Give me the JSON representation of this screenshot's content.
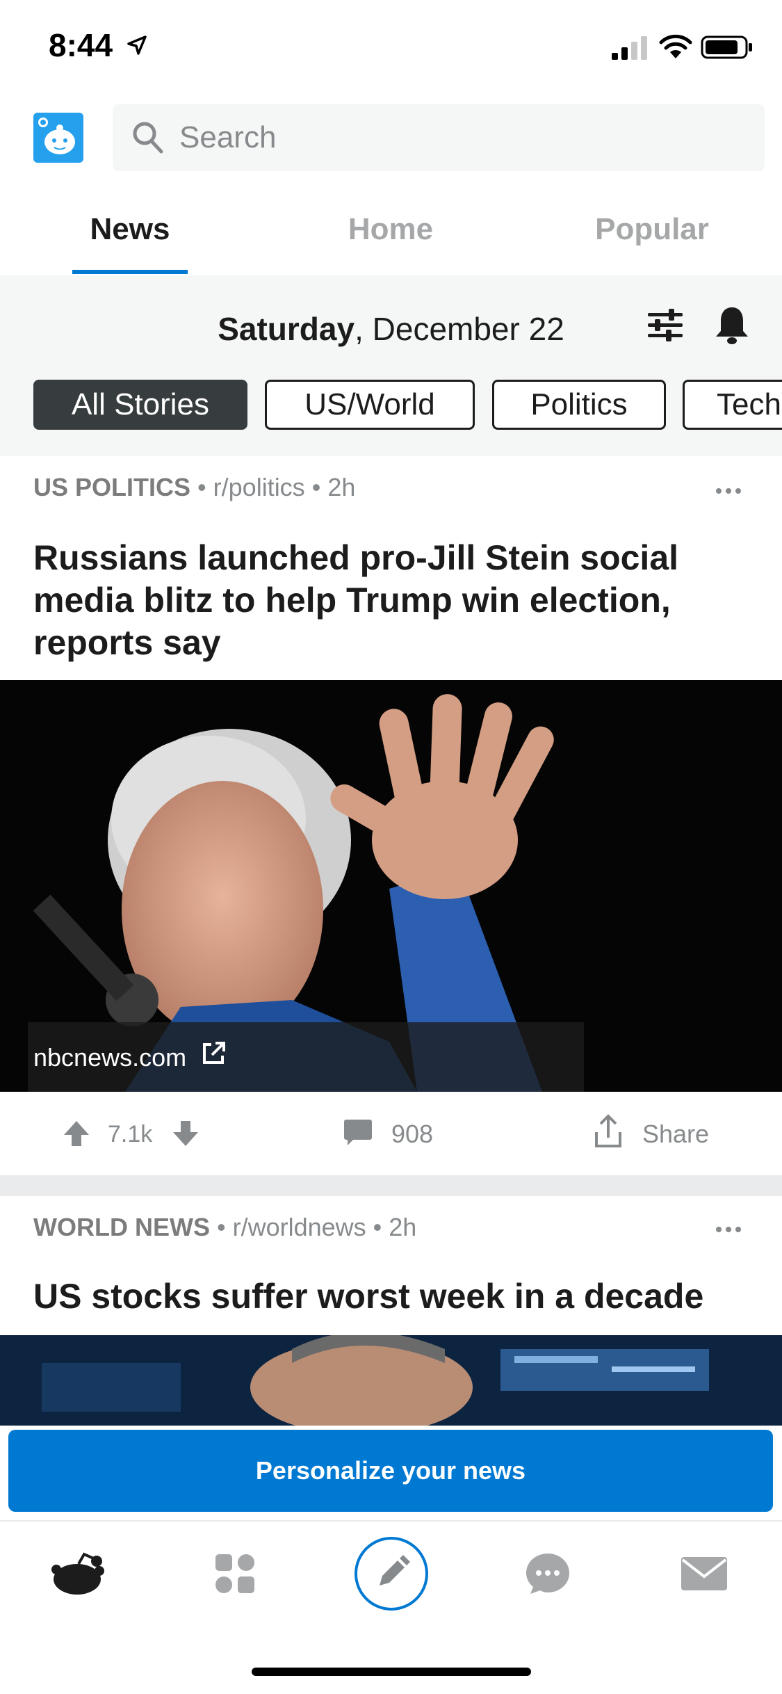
{
  "status_bar": {
    "time": "8:44"
  },
  "search": {
    "placeholder": "Search"
  },
  "tabs": [
    {
      "label": "News",
      "active": true
    },
    {
      "label": "Home",
      "active": false
    },
    {
      "label": "Popular",
      "active": false
    }
  ],
  "date": {
    "weekday": "Saturday",
    "rest": ", December 22"
  },
  "filters": [
    {
      "label": "All Stories",
      "selected": true
    },
    {
      "label": "US/World",
      "selected": false
    },
    {
      "label": "Politics",
      "selected": false
    },
    {
      "label": "Tech",
      "selected": false
    }
  ],
  "posts": [
    {
      "category": "US POLITICS",
      "subreddit": "r/politics",
      "age": "2h",
      "title": "Russians launched pro-Jill Stein social media blitz to help Trump win election, reports say",
      "source": "nbcnews.com",
      "votes": "7.1k",
      "comments": "908",
      "share_label": "Share"
    },
    {
      "category": "WORLD NEWS",
      "subreddit": "r/worldnews",
      "age": "2h",
      "title": "US stocks suffer worst week in a decade"
    }
  ],
  "cta": {
    "label": "Personalize your news"
  },
  "bottom_nav": [
    "home-icon",
    "communities-icon",
    "post-icon",
    "chat-icon",
    "inbox-icon"
  ],
  "colors": {
    "accent": "#0079d3",
    "text": "#1c1c1c",
    "muted": "#878a8c",
    "background_gray": "#f5f6f6"
  }
}
